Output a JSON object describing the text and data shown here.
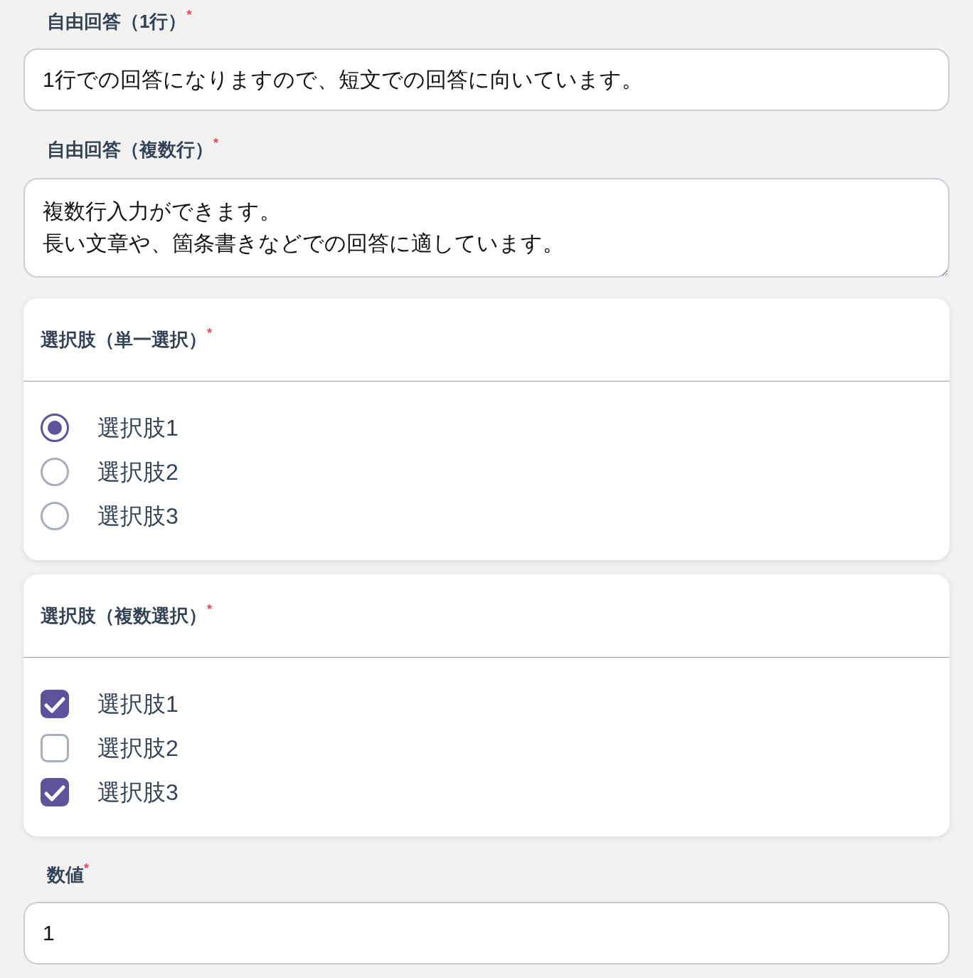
{
  "fields": [
    {
      "kind": "text",
      "label": "自由回答（1行）",
      "required_mark": "*",
      "value": "1行での回答になりますので、短文での回答に向いています。"
    },
    {
      "kind": "textarea",
      "label": "自由回答（複数行）",
      "required_mark": "*",
      "lines": [
        "複数行入力ができます。",
        "長い文章や、箇条書きなどでの回答に適しています。"
      ]
    },
    {
      "kind": "radio",
      "label": "選択肢（単一選択）",
      "required_mark": "*",
      "options": [
        {
          "label": "選択肢1",
          "selected": true
        },
        {
          "label": "選択肢2",
          "selected": false
        },
        {
          "label": "選択肢3",
          "selected": false
        }
      ]
    },
    {
      "kind": "checkbox",
      "label": "選択肢（複数選択）",
      "required_mark": "*",
      "options": [
        {
          "label": "選択肢1",
          "checked": true
        },
        {
          "label": "選択肢2",
          "checked": false
        },
        {
          "label": "選択肢3",
          "checked": true
        }
      ]
    },
    {
      "kind": "number",
      "label": "数値",
      "required_mark": "*",
      "value": "1"
    }
  ]
}
